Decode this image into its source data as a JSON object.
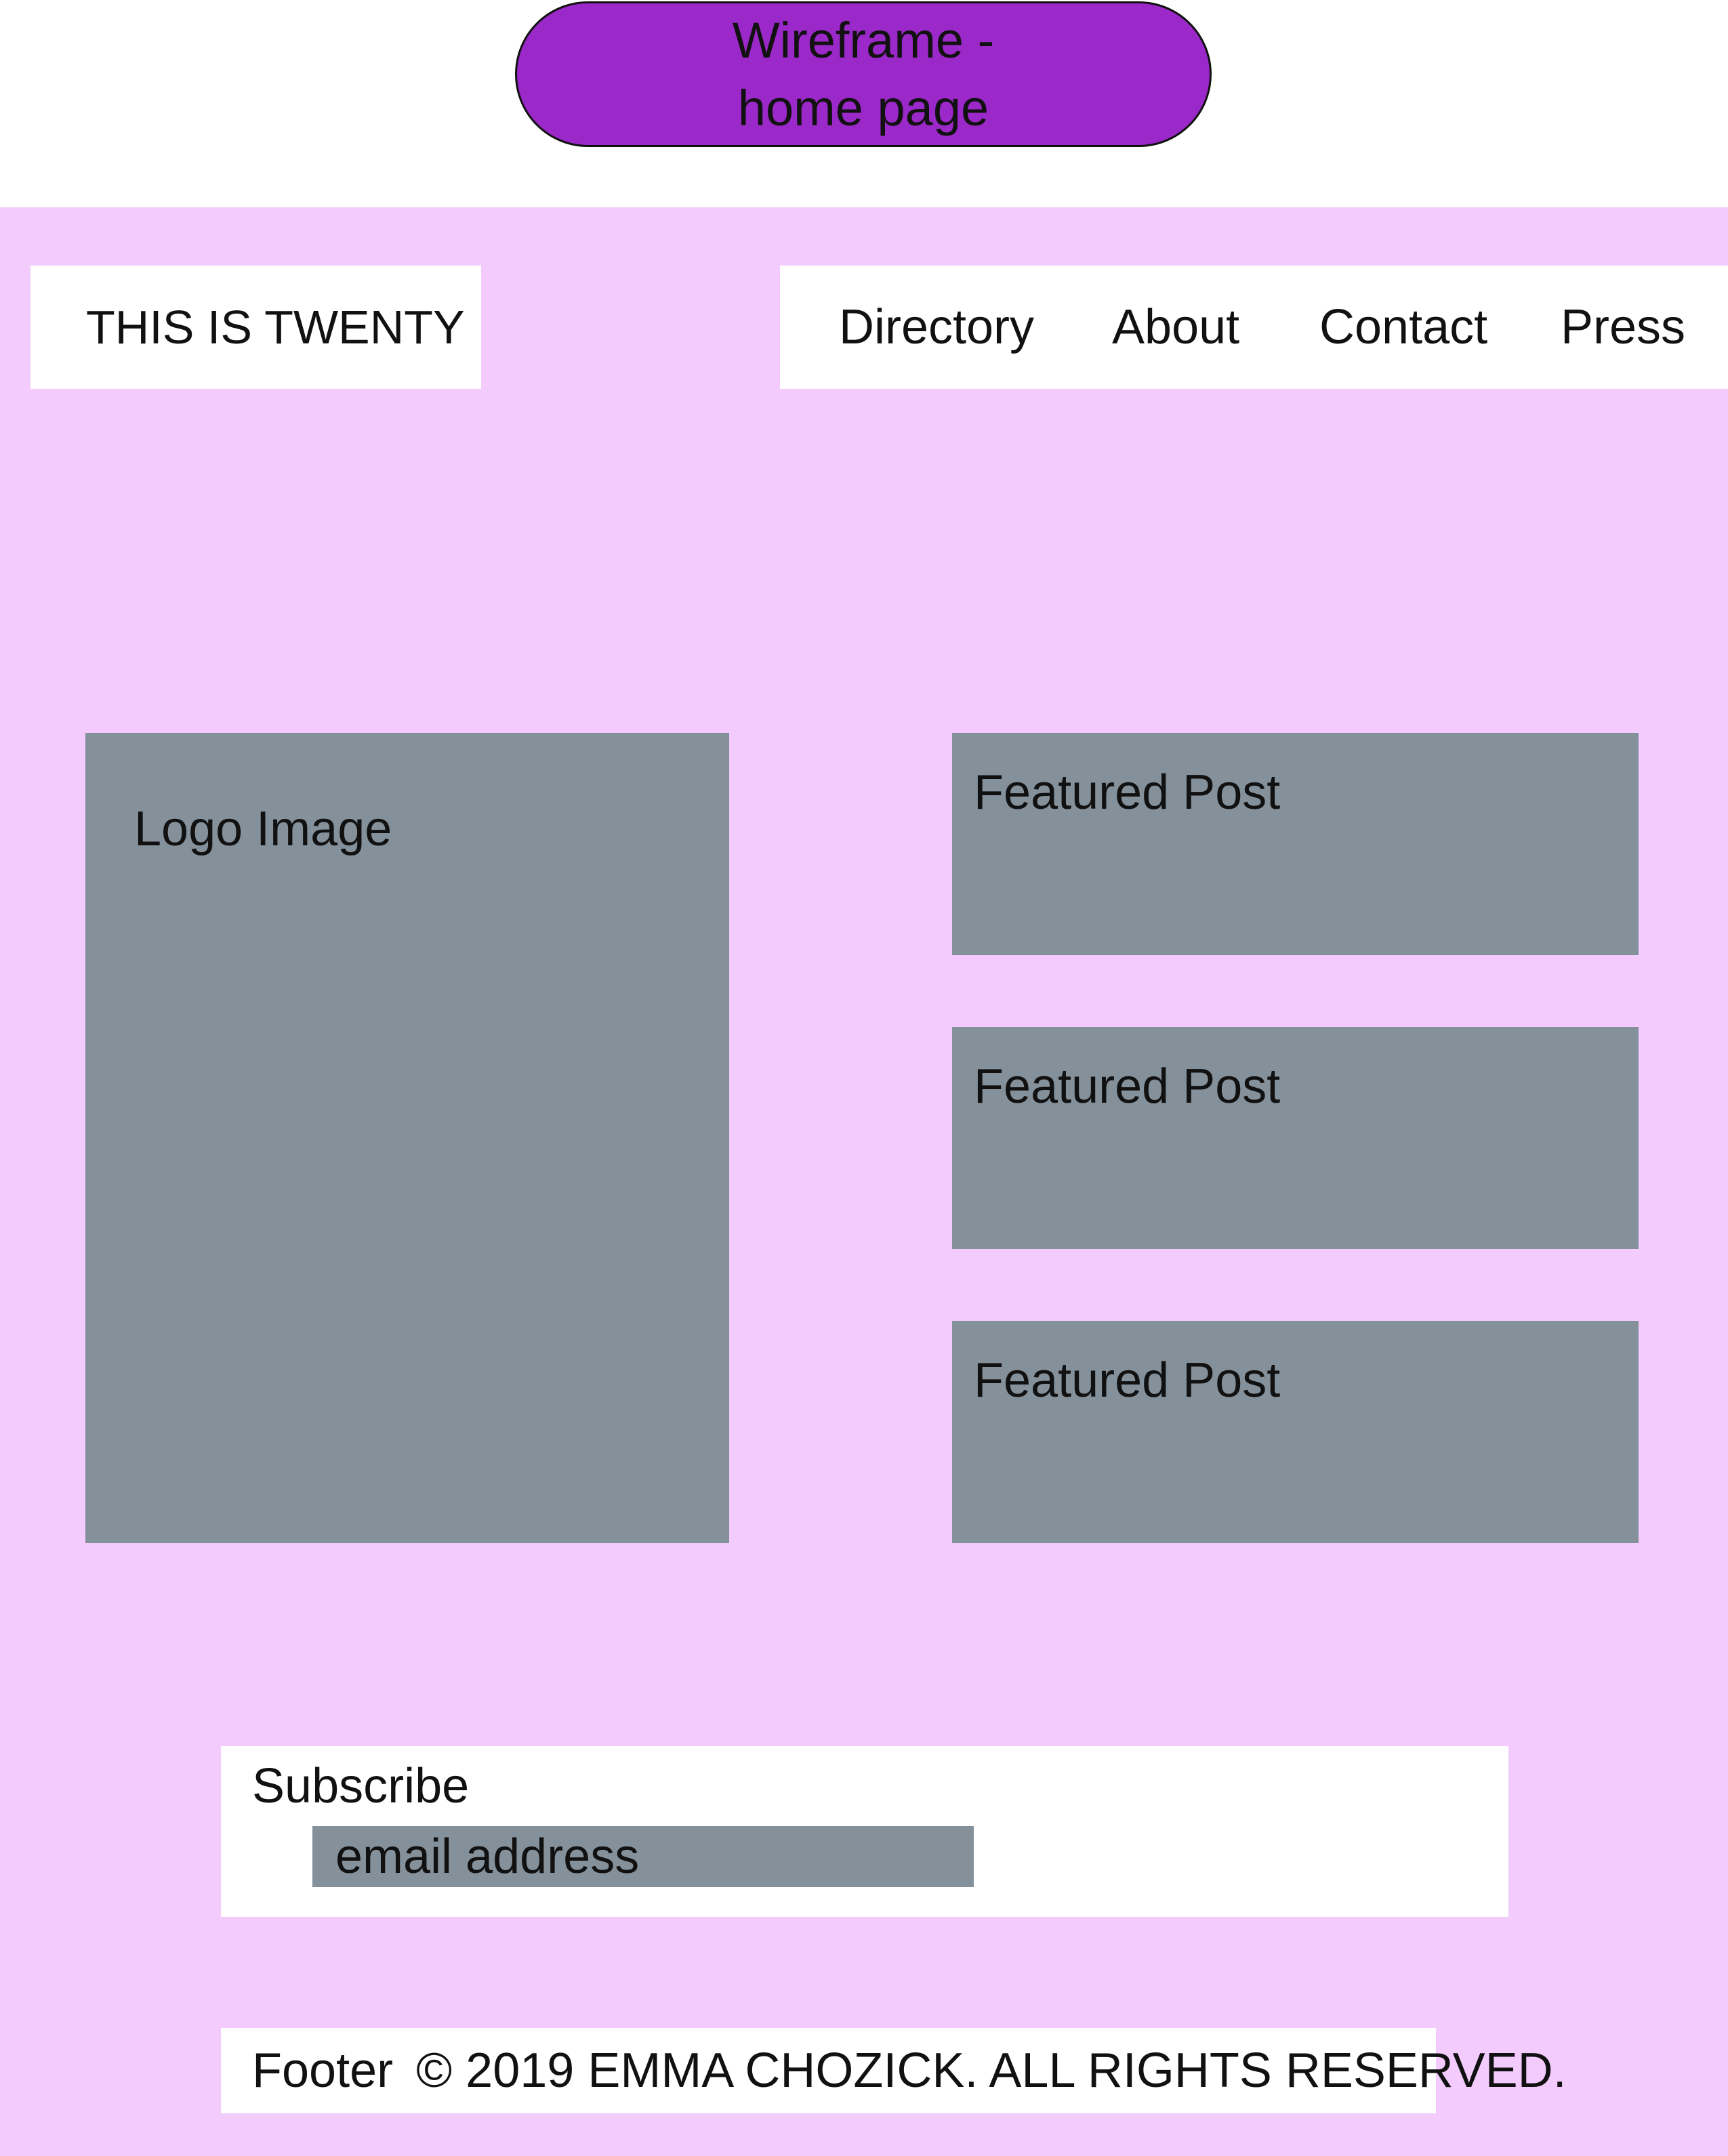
{
  "title": {
    "line1": "Wireframe -",
    "line2": "home page"
  },
  "header": {
    "site_title": "THIS IS TWENTY",
    "nav": [
      "Directory",
      "About",
      "Contact",
      "Press"
    ]
  },
  "main": {
    "logo_label": "Logo Image",
    "featured_posts": [
      "Featured Post",
      "Featured Post",
      "Featured Post"
    ]
  },
  "subscribe": {
    "label": "Subscribe",
    "email_placeholder": "email address"
  },
  "footer": {
    "label": "Footer",
    "copyright": "© 2019 EMMA CHOZICK. ALL RIGHTS RESERVED."
  },
  "colors": {
    "title_pill": "#9b28c8",
    "canvas_background": "#f3cbfc",
    "placeholder_grey": "#84909a",
    "panel_white": "#ffffff"
  }
}
